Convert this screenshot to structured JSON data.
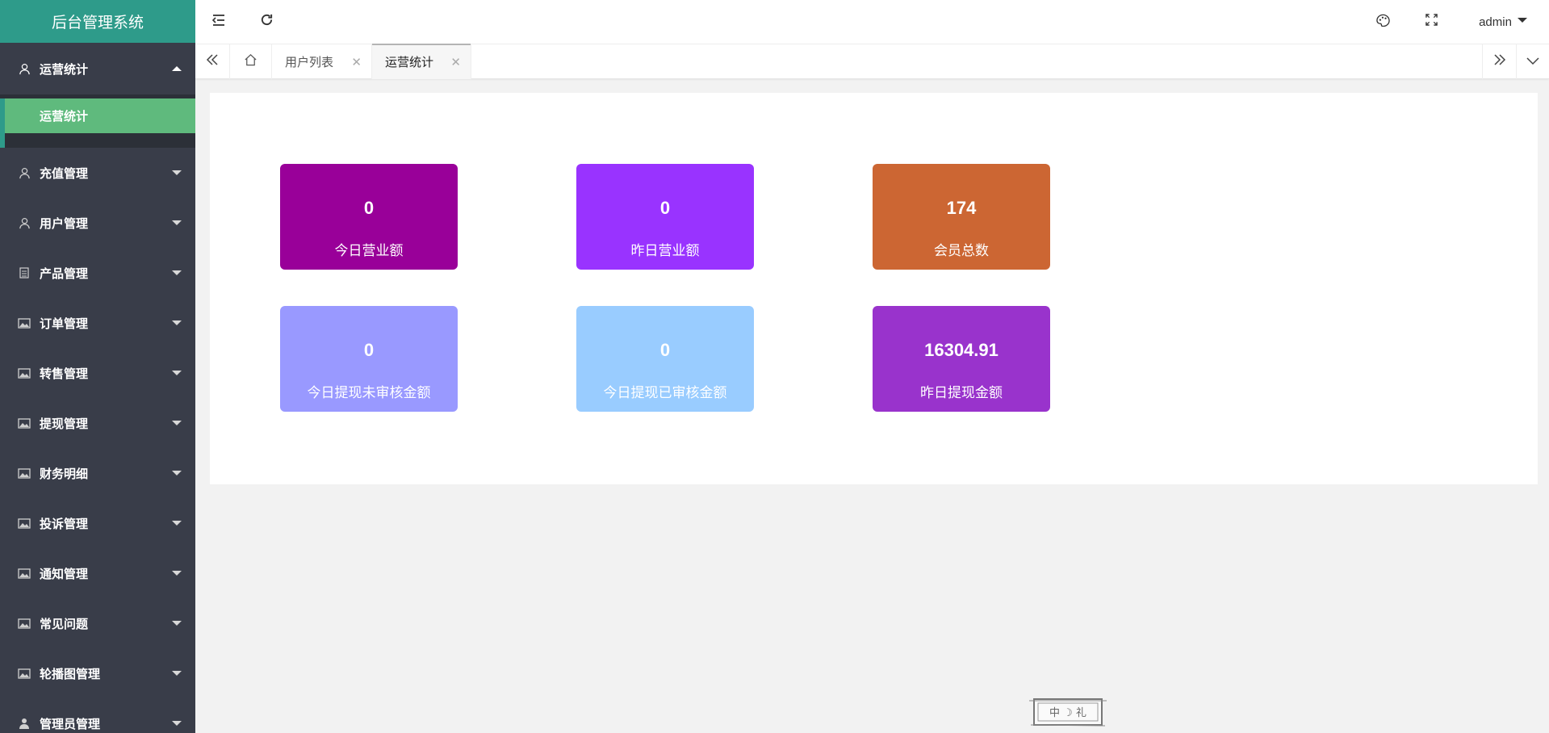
{
  "app": {
    "title": "后台管理系统"
  },
  "sidebar": {
    "items": [
      {
        "label": "运营统计",
        "icon": "user-icon",
        "expanded": true,
        "children": [
          {
            "label": "运营统计",
            "active": true
          }
        ]
      },
      {
        "label": "充值管理",
        "icon": "user-icon"
      },
      {
        "label": "用户管理",
        "icon": "user-icon"
      },
      {
        "label": "产品管理",
        "icon": "document-icon"
      },
      {
        "label": "订单管理",
        "icon": "image-icon"
      },
      {
        "label": "转售管理",
        "icon": "image-icon"
      },
      {
        "label": "提现管理",
        "icon": "image-icon"
      },
      {
        "label": "财务明细",
        "icon": "image-icon"
      },
      {
        "label": "投诉管理",
        "icon": "image-icon"
      },
      {
        "label": "通知管理",
        "icon": "image-icon"
      },
      {
        "label": "常见问题",
        "icon": "image-icon"
      },
      {
        "label": "轮播图管理",
        "icon": "image-icon"
      },
      {
        "label": "管理员管理",
        "icon": "person-icon"
      }
    ]
  },
  "header": {
    "user": "admin",
    "icons": [
      "menu-toggle-icon",
      "refresh-icon",
      "palette-icon",
      "fullscreen-icon"
    ]
  },
  "tabs": {
    "items": [
      {
        "label": "用户列表",
        "active": false
      },
      {
        "label": "运营统计",
        "active": true
      }
    ],
    "icons": [
      "prev-page-icon",
      "home-icon",
      "next-page-icon",
      "dropdown-icon"
    ]
  },
  "stats": [
    {
      "value": "0",
      "label": "今日营业额",
      "color": "#990099"
    },
    {
      "value": "0",
      "label": "昨日营业额",
      "color": "#9933ff"
    },
    {
      "value": "174",
      "label": "会员总数",
      "color": "#cc6633"
    },
    {
      "value": "0",
      "label": "今日提现未审核金额",
      "color": "#9999ff"
    },
    {
      "value": "0",
      "label": "今日提现已审核金额",
      "color": "#99ccff"
    },
    {
      "value": "16304.91",
      "label": "昨日提现金额",
      "color": "#9933cc"
    }
  ],
  "stamp": {
    "text": "中 ☽ 礼"
  },
  "colors": {
    "sidebar": "#393d49",
    "logo": "#2e9b8a",
    "active_submenu": "#5fba7d"
  }
}
